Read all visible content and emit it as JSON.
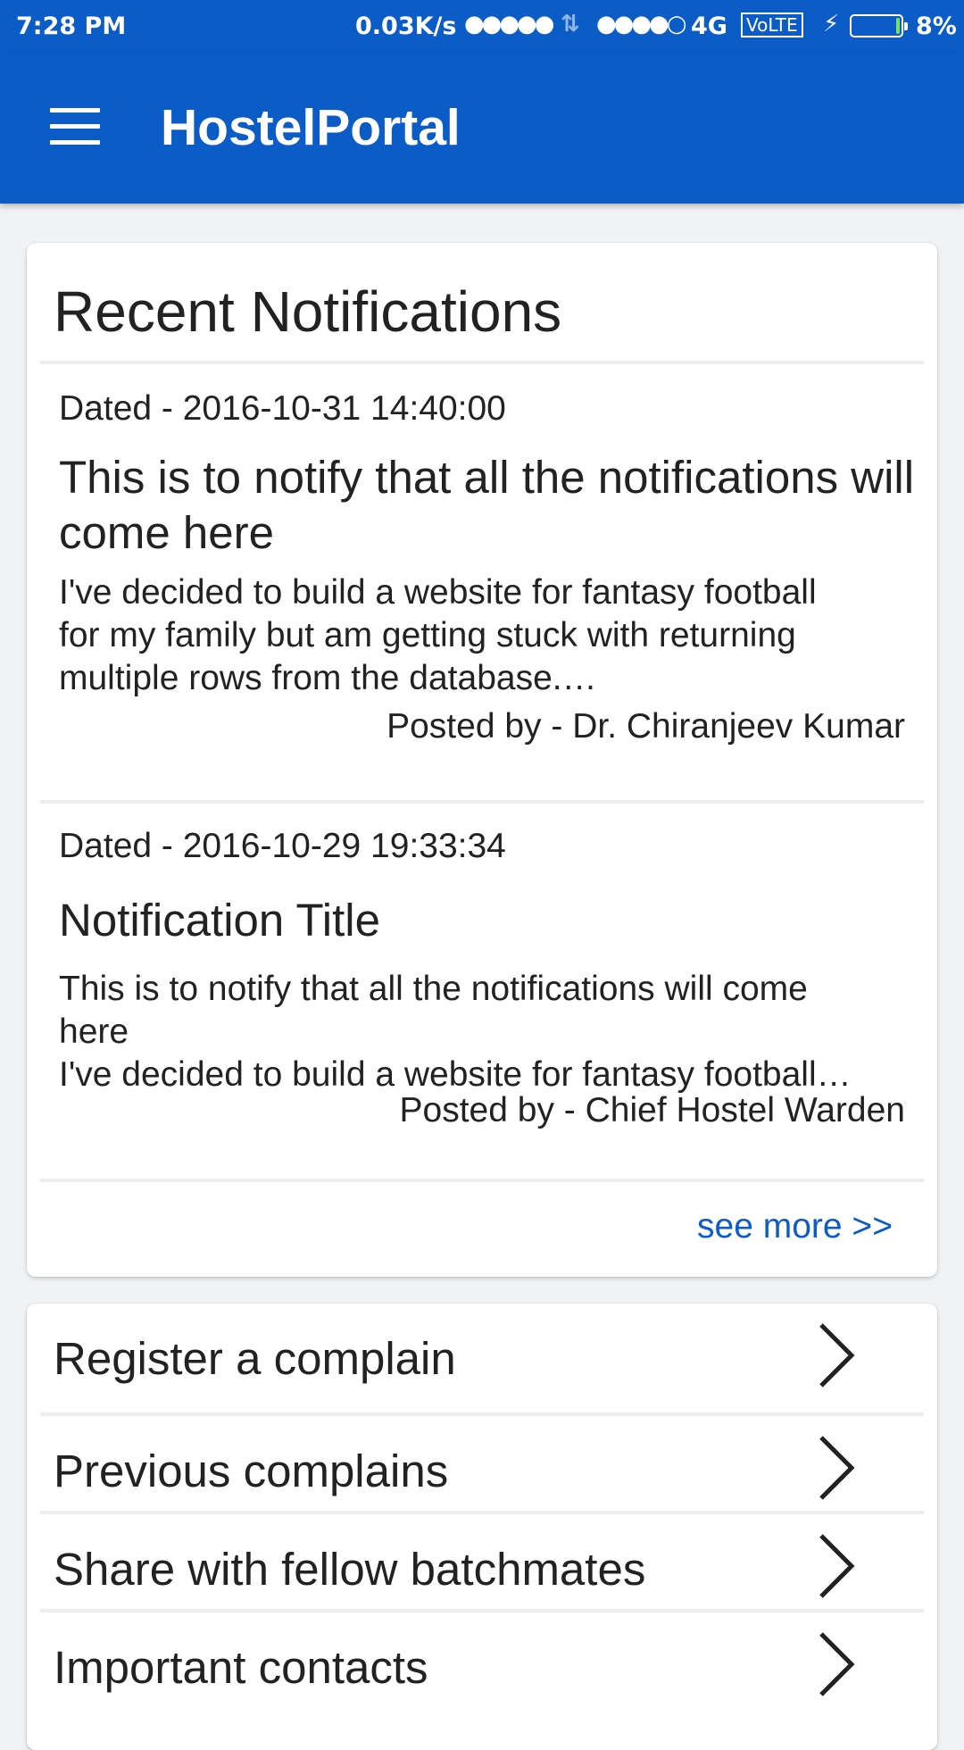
{
  "status_bar": {
    "time": "7:28 PM",
    "net_speed": "0.03K/s",
    "signal_1": "●●●●●",
    "data_arrows": "⇅",
    "signal_2": "●●●●○",
    "network": "4G",
    "volte": "VoLTE",
    "charging": "⚡",
    "battery_pct": "8%",
    "battery_level": 0.08
  },
  "app_bar": {
    "menu_icon": "hamburger-menu-icon",
    "title": "HostelPortal"
  },
  "notifications": {
    "heading": "Recent Notifications",
    "items": [
      {
        "dated": "Dated - 2016-10-31 14:40:00",
        "title": "This is to notify that all the notifications will come here",
        "body_lines": [
          "I've decided to build a website for fantasy football",
          "for my family but am getting stuck with returning",
          "multiple rows from the database.…"
        ],
        "posted_by": "Posted by - Dr. Chiranjeev Kumar"
      },
      {
        "dated": "Dated - 2016-10-29 19:33:34",
        "title": "Notification Title",
        "body_lines": [
          "This is to notify that all the notifications will come",
          "here",
          "I've decided to build a website for fantasy football…"
        ],
        "posted_by": "Posted by - Chief Hostel Warden"
      }
    ],
    "see_more": "see more >>"
  },
  "menu": {
    "items": [
      {
        "label": "Register a complain",
        "icon": "chevron-right-icon"
      },
      {
        "label": "Previous complains",
        "icon": "chevron-right-icon"
      },
      {
        "label": "Share with fellow batchmates",
        "icon": "chevron-right-icon"
      },
      {
        "label": "Important contacts",
        "icon": "chevron-right-icon"
      }
    ]
  },
  "colors": {
    "primary": "#0c5cc8",
    "background": "#f1f2f4",
    "card": "#ffffff",
    "text": "#222222",
    "link": "#0c5cc8"
  }
}
